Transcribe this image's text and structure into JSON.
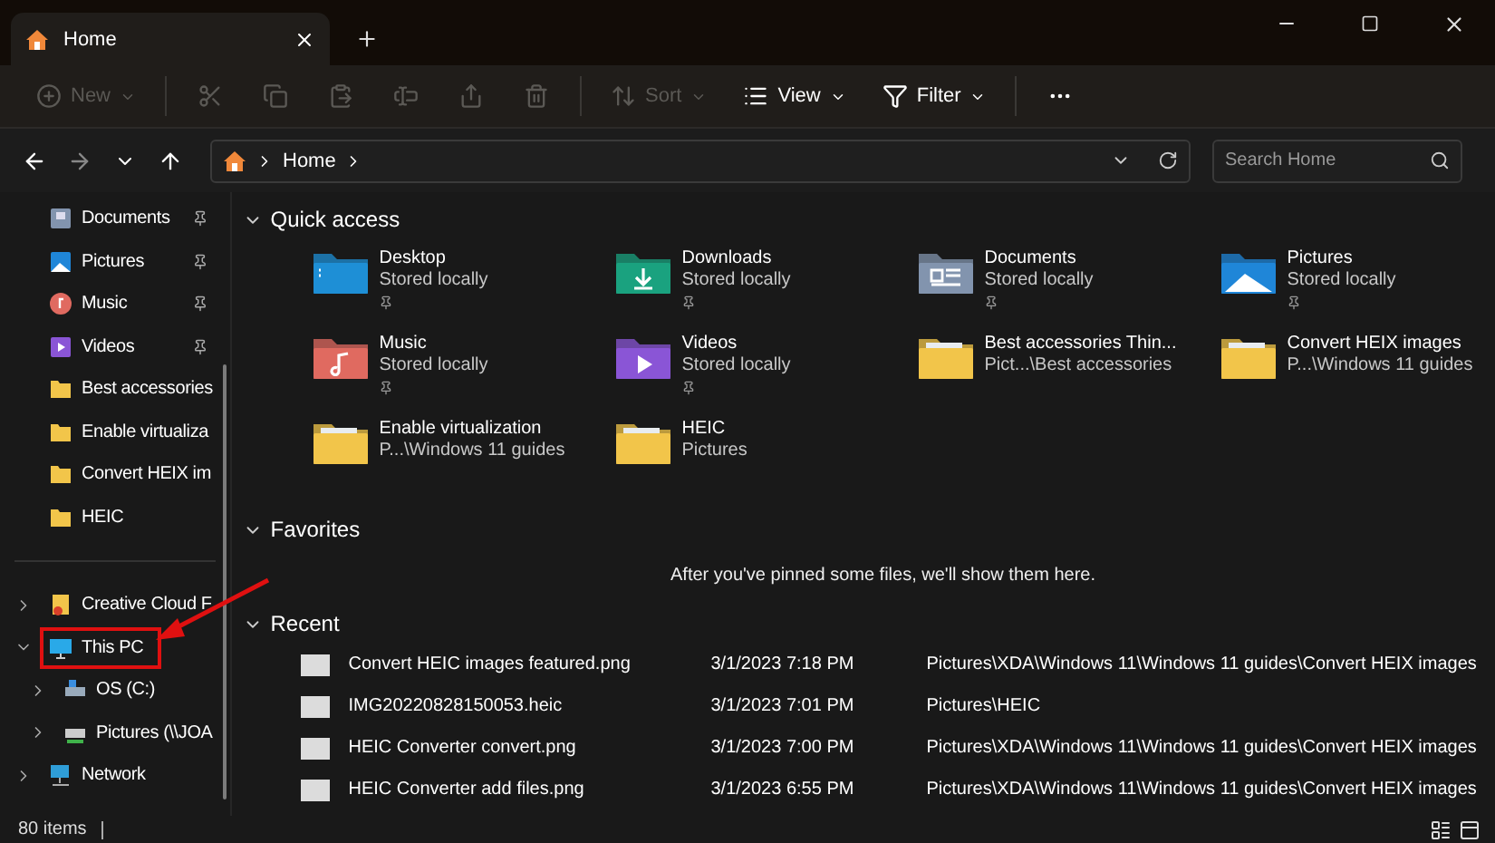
{
  "tabs": [
    {
      "title": "Home",
      "selected": true
    }
  ],
  "toolbar": [
    {
      "kind": "new",
      "label": "New",
      "disabled": true
    },
    {
      "kind": "cut",
      "disabled": true
    },
    {
      "kind": "copy",
      "disabled": true
    },
    {
      "kind": "paste",
      "disabled": true
    },
    {
      "kind": "rename",
      "disabled": true
    },
    {
      "kind": "share",
      "disabled": true
    },
    {
      "kind": "delete",
      "disabled": true
    },
    {
      "kind": "sort",
      "label": "Sort",
      "disabled": true
    },
    {
      "kind": "view",
      "label": "View",
      "disabled": false
    },
    {
      "kind": "filter",
      "label": "Filter",
      "disabled": false
    },
    {
      "kind": "more",
      "disabled": false
    }
  ],
  "address": {
    "path": [
      "Home"
    ],
    "search_placeholder": "Search Home"
  },
  "sidebar": {
    "quick": [
      {
        "kind": "documents",
        "label": "Documents",
        "pinned": true
      },
      {
        "kind": "pictures",
        "label": "Pictures",
        "pinned": true
      },
      {
        "kind": "music",
        "label": "Music",
        "pinned": true
      },
      {
        "kind": "videos",
        "label": "Videos",
        "pinned": true
      },
      {
        "kind": "folder",
        "label": "Best accessories",
        "pinned": false
      },
      {
        "kind": "folder",
        "label": "Enable virtualiza",
        "pinned": false
      },
      {
        "kind": "folder",
        "label": "Convert HEIX im",
        "pinned": false
      },
      {
        "kind": "folder",
        "label": "HEIC",
        "pinned": false
      }
    ],
    "tree": [
      {
        "kind": "cloud",
        "label": "Creative Cloud F",
        "expanded": false,
        "highlighted": false
      },
      {
        "kind": "pc",
        "label": "This PC",
        "expanded": true,
        "highlighted": true,
        "children": [
          {
            "kind": "drive",
            "label": "OS (C:)",
            "expanded": false,
            "highlighted": false
          },
          {
            "kind": "netdrive",
            "label": "Pictures (\\\\JOA",
            "expanded": false,
            "highlighted": false
          }
        ]
      },
      {
        "kind": "network",
        "label": "Network",
        "expanded": false,
        "highlighted": false
      }
    ]
  },
  "quick_access": {
    "title": "Quick access",
    "items": [
      {
        "kind": "desktop",
        "title": "Desktop",
        "subtitle": "Stored locally",
        "pinned": true
      },
      {
        "kind": "downloads",
        "title": "Downloads",
        "subtitle": "Stored locally",
        "pinned": true
      },
      {
        "kind": "documents",
        "title": "Documents",
        "subtitle": "Stored locally",
        "pinned": true
      },
      {
        "kind": "pictures",
        "title": "Pictures",
        "subtitle": "Stored locally",
        "pinned": true
      },
      {
        "kind": "music",
        "title": "Music",
        "subtitle": "Stored locally",
        "pinned": true
      },
      {
        "kind": "videos",
        "title": "Videos",
        "subtitle": "Stored locally",
        "pinned": true
      },
      {
        "kind": "folder",
        "title": "Best accessories Thin...",
        "subtitle": "Pict...\\Best accessories",
        "pinned": false
      },
      {
        "kind": "folder",
        "title": "Convert HEIX images",
        "subtitle": "P...\\Windows 11 guides",
        "pinned": false
      },
      {
        "kind": "folder",
        "title": "Enable virtualization",
        "subtitle": "P...\\Windows 11 guides",
        "pinned": false
      },
      {
        "kind": "folder",
        "title": "HEIC",
        "subtitle": "Pictures",
        "pinned": false
      }
    ]
  },
  "favorites": {
    "title": "Favorites",
    "empty_message": "After you've pinned some files, we'll show them here."
  },
  "recent": {
    "title": "Recent",
    "rows": [
      {
        "name": "Convert HEIC images featured.png",
        "date": "3/1/2023 7:18 PM",
        "path": "Pictures\\XDA\\Windows 11\\Windows 11 guides\\Convert HEIX images"
      },
      {
        "name": "IMG20220828150053.heic",
        "date": "3/1/2023 7:01 PM",
        "path": "Pictures\\HEIC"
      },
      {
        "name": "HEIC Converter convert.png",
        "date": "3/1/2023 7:00 PM",
        "path": "Pictures\\XDA\\Windows 11\\Windows 11 guides\\Convert HEIX images"
      },
      {
        "name": "HEIC Converter add files.png",
        "date": "3/1/2023 6:55 PM",
        "path": "Pictures\\XDA\\Windows 11\\Windows 11 guides\\Convert HEIX images"
      }
    ]
  },
  "status_bar": {
    "count": "80 items"
  }
}
